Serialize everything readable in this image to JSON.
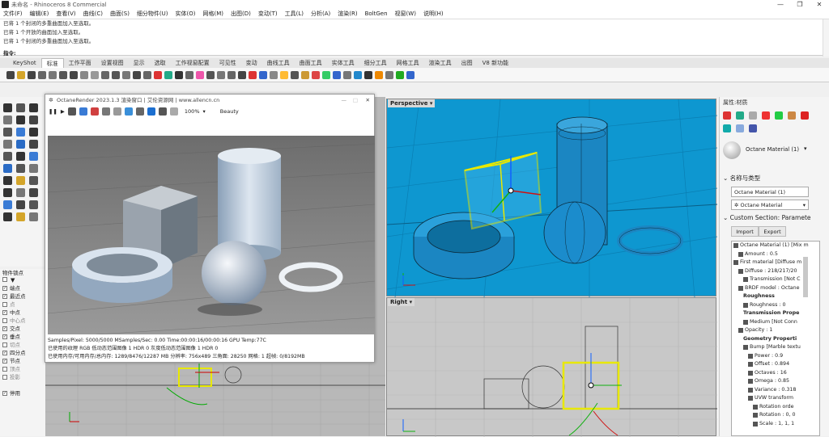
{
  "window": {
    "title": "未命名 - Rhinoceros 8 Commercial"
  },
  "menu": [
    "文件(F)",
    "编辑(E)",
    "查看(V)",
    "曲线(C)",
    "曲面(S)",
    "细分物件(U)",
    "实体(O)",
    "网格(M)",
    "出图(D)",
    "变动(T)",
    "工具(L)",
    "分析(A)",
    "渲染(R)",
    "BoltGen",
    "视窗(W)",
    "说明(H)"
  ],
  "command": {
    "history": [
      "已将 1 个封闭的多重曲面加入至选取。",
      "已将 1 个开放的曲面加入至选取。",
      "已将 1 个封闭的多重曲面加入至选取。"
    ],
    "prompt": "指令:"
  },
  "tabs": [
    "KeyShot",
    "标准",
    "工作平面",
    "设置视图",
    "显示",
    "选取",
    "工作视窗配置",
    "可见性",
    "变动",
    "曲线工具",
    "曲面工具",
    "实体工具",
    "细分工具",
    "网格工具",
    "渲染工具",
    "出图",
    "V8 新功能"
  ],
  "active_tab": "标准",
  "osnap": {
    "header": "物件锁点",
    "items": [
      {
        "label": "端点",
        "on": true
      },
      {
        "label": "最近点",
        "on": true
      },
      {
        "label": "点",
        "on": false
      },
      {
        "label": "中点",
        "on": true
      },
      {
        "label": "中心点",
        "on": false
      },
      {
        "label": "交点",
        "on": true
      },
      {
        "label": "垂点",
        "on": true
      },
      {
        "label": "切点",
        "on": false
      },
      {
        "label": "四分点",
        "on": true
      },
      {
        "label": "节点",
        "on": true
      },
      {
        "label": "顶点",
        "on": false
      },
      {
        "label": "投影",
        "on": false
      },
      {
        "label": "停用",
        "on": true
      }
    ]
  },
  "octane": {
    "title": "OctaneRender 2023.1.3 渲染窗口 | 艾伦资源网 | www.allencn.cn",
    "zoom": "100%",
    "mode": "Beauty",
    "status_lines": [
      "Samples/Pixel: 5000/5000  MSamples/Sec: 0.00  Time:00:00:16/00:00:16  GPU Temp:77C",
      "已使用的纹理 RGB 低动态范围图像 1  HDR 0  灰度低动态范围图像 1  HDR 0",
      "已使用内存/可用内存/总内存:    1289/8476/12287 MB  分辨率:    756x489  三角面:    28250  网格:  1  超帧:    0/8192MB"
    ]
  },
  "viewports": {
    "perspective": "Perspective",
    "right": "Right"
  },
  "properties": {
    "header": "属性:材质",
    "material_name": "Octane Material (1)",
    "section_name_type": "名称与类型",
    "name_value": "Octane Material (1)",
    "type_value": "Octane Material",
    "section_custom": "Custom Section: Paramete",
    "import_label": "Import",
    "export_label": "Export",
    "tree": [
      "Octane Material (1)  [Mix m",
      "Amount : 0.5",
      "First material  [Diffuse m",
      "Diffuse : 218/217/20",
      "Transmission  [Not C",
      "BRDF model : Octane",
      "Roughness",
      "Roughness : 0",
      "Transmission Prope",
      "Medium  [Not Conn",
      "Opacity : 1",
      "Geometry Properti",
      "Bump  [Marble textu",
      "Power : 0.9",
      "Offset : 0.894",
      "Octaves : 16",
      "Omega : 0.85",
      "Variance : 0.318",
      "UVW transform",
      "Rotation orde",
      "Rotation : 0, 0",
      "Scale : 1, 1, 1"
    ]
  },
  "colors": {
    "viewport_blue": "#0e97d0",
    "selection_yellow": "#e8e800",
    "octane_floor": "#8a8a8a"
  }
}
